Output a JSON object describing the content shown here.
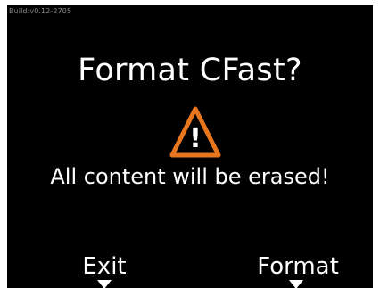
{
  "build_label": "Build:v0.12-2705",
  "dialog": {
    "title": "Format CFast?",
    "icon": "warning-triangle-icon",
    "icon_glyph": "!",
    "message": "All content will be erased!"
  },
  "softkeys": {
    "left_label": "Exit",
    "right_label": "Format"
  },
  "colors": {
    "background": "#000000",
    "text": "#ffffff",
    "warning": "#e8761e",
    "build_text": "#8a8a8a"
  }
}
